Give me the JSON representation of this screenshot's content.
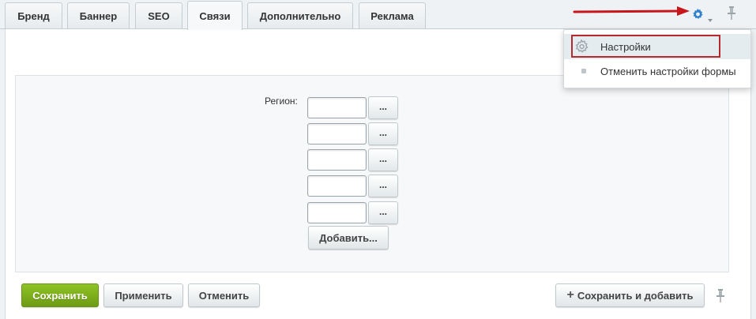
{
  "tabs": [
    {
      "label": "Бренд"
    },
    {
      "label": "Баннер"
    },
    {
      "label": "SEO"
    },
    {
      "label": "Связи"
    },
    {
      "label": "Дополнительно"
    },
    {
      "label": "Реклама"
    }
  ],
  "active_tab": "Связи",
  "toolbar": {
    "settings_icon": "gear-icon",
    "pin_icon": "pin-icon",
    "accent_color": "#2f7fcf"
  },
  "menu": {
    "items": [
      {
        "label": "Настройки",
        "icon": "gear-icon"
      },
      {
        "label": "Отменить настройки формы",
        "icon": "bullet"
      }
    ],
    "highlight_color": "#b4292e"
  },
  "form": {
    "region_label": "Регион:",
    "region_inputs": [
      "",
      "",
      "",
      "",
      ""
    ],
    "dots_label": "...",
    "add_label": "Добавить..."
  },
  "footer": {
    "save": "Сохранить",
    "apply": "Применить",
    "cancel": "Отменить",
    "save_and_add": "Сохранить и добавить",
    "save_color": "#7cae1d"
  }
}
